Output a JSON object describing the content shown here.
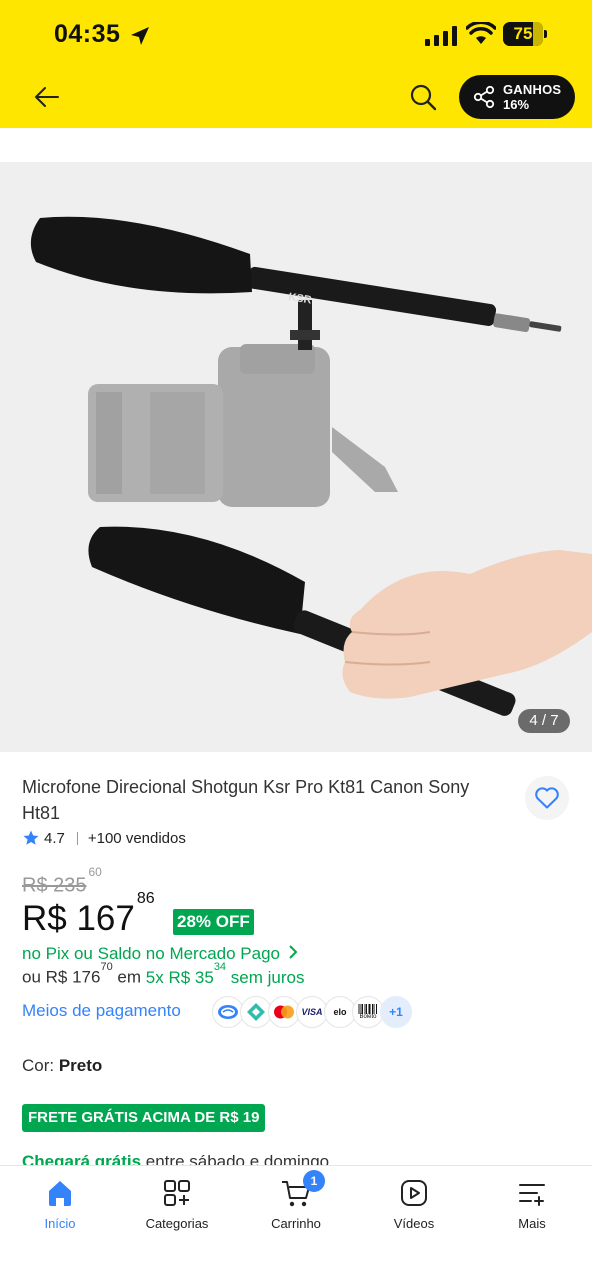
{
  "status_bar": {
    "time": "04:35",
    "battery": "75",
    "battery_level": 0.75
  },
  "header": {
    "share_title": "GANHOS",
    "share_percent": "16%"
  },
  "gallery": {
    "counter": "4 / 7",
    "current_index": 4,
    "total_images": 7,
    "image_brand_text": "KSR"
  },
  "product": {
    "title": "Microfone Direcional Shotgun Ksr Pro Kt81 Canon Sony Ht81",
    "rating": "4.7",
    "sold": "+100 vendidos",
    "old_price": "R$ 235",
    "old_price_cents": "60",
    "price": "R$ 167",
    "price_cents": "86",
    "discount": "28% OFF",
    "pix_text": "no Pix ou Saldo no Mercado Pago",
    "install_prefix": "ou R$ 176",
    "install_prefix_cents": "70",
    "install_mid": " em ",
    "install_green": "5x R$ 35",
    "install_green_cents": "34",
    "install_suffix": " sem juros",
    "payment_link": "Meios de pagamento",
    "payment_icons": [
      "mercado-pago-icon",
      "pix-icon",
      "mastercard-icon",
      "visa-icon",
      "elo-icon",
      "boleto-icon"
    ],
    "payment_visa": "VISA",
    "payment_elo": "elo",
    "payment_boleto": "Boleto",
    "payment_more": "+1",
    "color_label": "Cor: ",
    "color_value": "Preto",
    "shipping_badge": "FRETE GRÁTIS ACIMA DE R$ 19",
    "arrive_green": "Chegará grátis",
    "arrive_rest": " entre sábado e domingo"
  },
  "bottom_nav": {
    "items": [
      {
        "label": "Início",
        "icon": "home-icon",
        "active": true
      },
      {
        "label": "Categorias",
        "icon": "categories-icon",
        "active": false
      },
      {
        "label": "Carrinho",
        "icon": "cart-icon",
        "active": false,
        "badge": "1"
      },
      {
        "label": "Vídeos",
        "icon": "video-icon",
        "active": false
      },
      {
        "label": "Mais",
        "icon": "more-menu-icon",
        "active": false
      }
    ]
  },
  "colors": {
    "brand_yellow": "#FFE600",
    "accent_blue": "#3483FA",
    "success_green": "#00A650"
  }
}
